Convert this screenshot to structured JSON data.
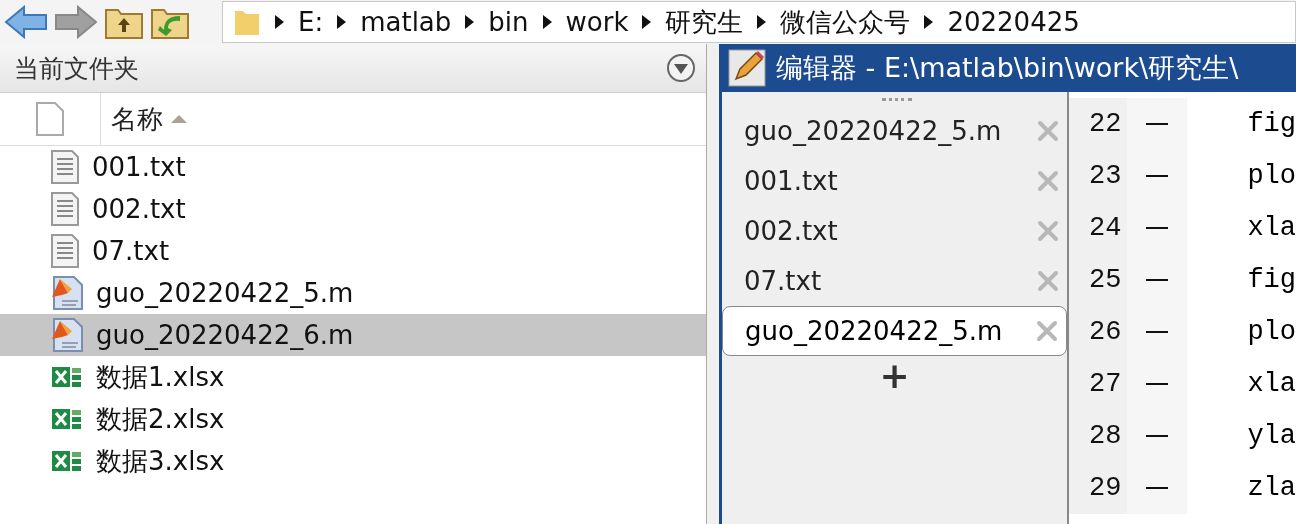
{
  "toolbar": {
    "breadcrumb": [
      "E:",
      "matlab",
      "bin",
      "work",
      "研究生",
      "微信公众号",
      "20220425"
    ]
  },
  "current_folder": {
    "title": "当前文件夹",
    "column": "名称",
    "files": [
      {
        "name": "001.txt",
        "kind": "txt",
        "selected": false
      },
      {
        "name": "002.txt",
        "kind": "txt",
        "selected": false
      },
      {
        "name": "07.txt",
        "kind": "txt",
        "selected": false
      },
      {
        "name": "guo_20220422_5.m",
        "kind": "m",
        "selected": false
      },
      {
        "name": "guo_20220422_6.m",
        "kind": "m",
        "selected": true
      },
      {
        "name": "数据1.xlsx",
        "kind": "xlsx",
        "selected": false
      },
      {
        "name": "数据2.xlsx",
        "kind": "xlsx",
        "selected": false
      },
      {
        "name": "数据3.xlsx",
        "kind": "xlsx",
        "selected": false
      }
    ]
  },
  "editor": {
    "title": "编辑器 - E:\\matlab\\bin\\work\\研究生\\",
    "tabs": [
      {
        "label": "guo_20220422_5.m",
        "selected": false
      },
      {
        "label": "001.txt",
        "selected": false
      },
      {
        "label": "002.txt",
        "selected": false
      },
      {
        "label": "07.txt",
        "selected": false
      },
      {
        "label": "guo_20220422_5.m",
        "selected": true
      }
    ],
    "add_tab": "+",
    "lines": [
      {
        "number": "22",
        "code": "fig"
      },
      {
        "number": "23",
        "code": "plo"
      },
      {
        "number": "24",
        "code": "xla"
      },
      {
        "number": "25",
        "code": "fig"
      },
      {
        "number": "26",
        "code": "plo"
      },
      {
        "number": "27",
        "code": "xla"
      },
      {
        "number": "28",
        "code": "yla"
      },
      {
        "number": "29",
        "code": "zla"
      }
    ]
  }
}
